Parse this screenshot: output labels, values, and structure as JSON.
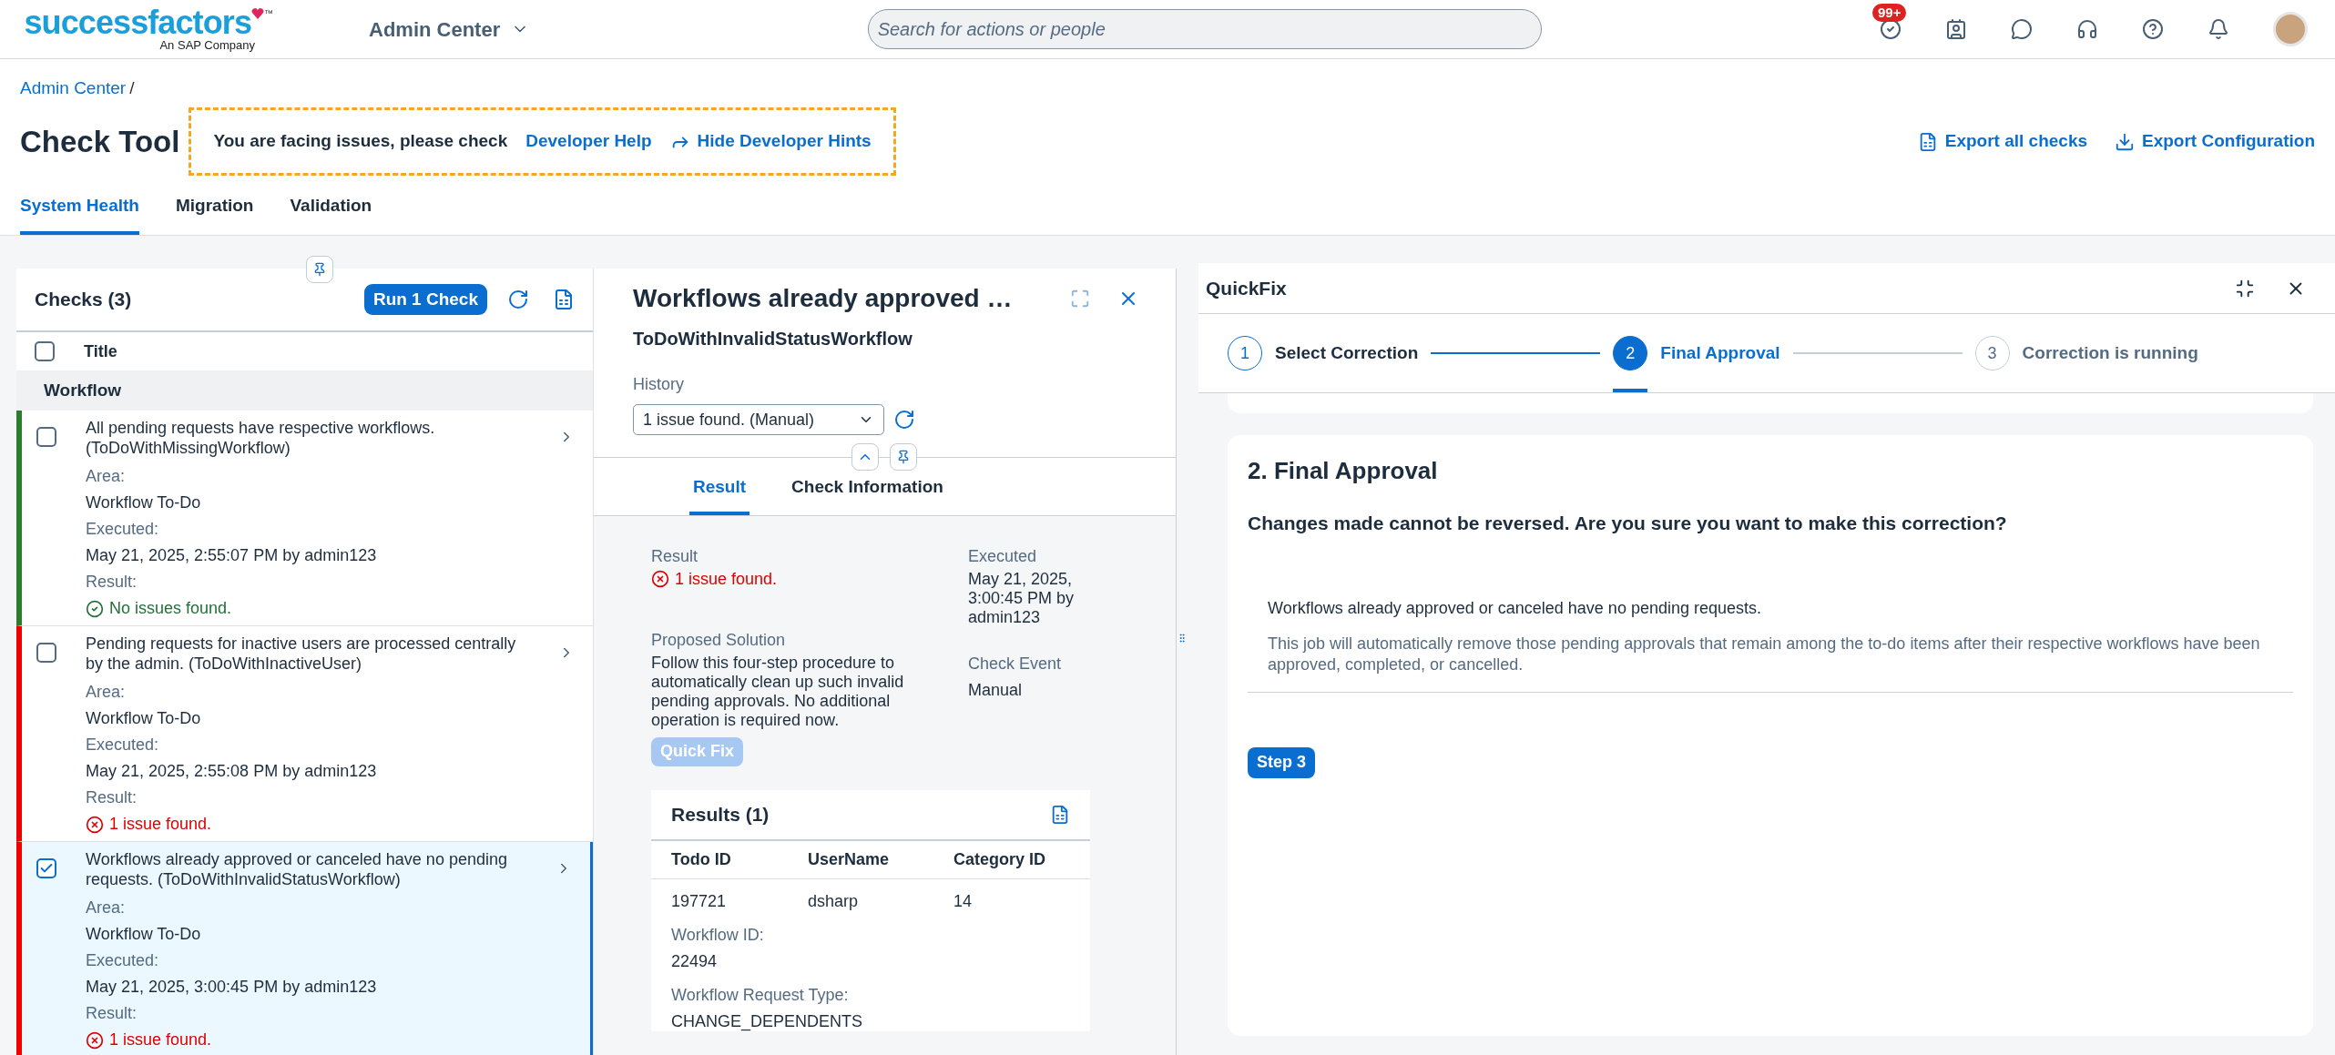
{
  "header": {
    "logo": {
      "name": "successfactors",
      "trademark": "™",
      "tagline": "An SAP Company"
    },
    "app_menu": "Admin Center",
    "search": {
      "placeholder": "Search for actions or people"
    },
    "badge": "99+"
  },
  "breadcrumb": [
    "Admin Center",
    "/"
  ],
  "page": {
    "title": "Check Tool",
    "hint": {
      "text": "You are facing issues, please check",
      "link": "Developer Help",
      "action": "Hide Developer Hints"
    },
    "actions": [
      "Export all checks",
      "Export Configuration"
    ]
  },
  "tabs": [
    {
      "label": "System Health",
      "selected": true
    },
    {
      "label": "Migration",
      "selected": false
    },
    {
      "label": "Validation",
      "selected": false
    }
  ],
  "checks": {
    "title": "Checks (3)",
    "run_button": "Run 1 Check",
    "column": "Title",
    "all_checked": false,
    "group": "Workflow",
    "rows": [
      {
        "title": "All pending requests have respective workflows. (ToDoWithMissingWorkflow)",
        "area_label": "Area:",
        "area": "Workflow To-Do",
        "executed_label": "Executed:",
        "executed": "May 21, 2025, 2:55:07 PM by admin123",
        "result_label": "Result:",
        "result": "No issues found.",
        "kind": "ok",
        "checked": false,
        "selected": false
      },
      {
        "title": "Pending requests for inactive users are processed centrally by the admin. (ToDoWithInactiveUser)",
        "area_label": "Area:",
        "area": "Workflow To-Do",
        "executed_label": "Executed:",
        "executed": "May 21, 2025, 2:55:08 PM by admin123",
        "result_label": "Result:",
        "result": "1 issue found.",
        "kind": "issue",
        "checked": false,
        "selected": false
      },
      {
        "title": "Workflows already approved or canceled have no pending requests. (ToDoWithInvalidStatusWorkflow)",
        "area_label": "Area:",
        "area": "Workflow To-Do",
        "executed_label": "Executed:",
        "executed": "May 21, 2025, 3:00:45 PM by admin123",
        "result_label": "Result:",
        "result": "1 issue found.",
        "kind": "issue",
        "checked": true,
        "selected": true
      }
    ]
  },
  "detail": {
    "title": "Workflows already approved …",
    "subtitle": "ToDoWithInvalidStatusWorkflow",
    "history_label": "History",
    "history_value": "1 issue found. (Manual)",
    "tabs": [
      {
        "label": "Result",
        "selected": true
      },
      {
        "label": "Check Information",
        "selected": false
      }
    ],
    "result_label": "Result",
    "result": {
      "text": "1 issue found.",
      "kind": "issue"
    },
    "executed_label": "Executed",
    "executed": "May 21, 2025, 3:00:45 PM by admin123",
    "solution_label": "Proposed Solution",
    "solution": "Follow this four-step procedure to automatically clean up such invalid pending approvals. No additional operation is required now.",
    "event_label": "Check Event",
    "event": "Manual",
    "quick_fix": {
      "label": "Quick Fix",
      "disabled": true
    },
    "results": {
      "title": "Results (1)",
      "columns": [
        "Todo ID",
        "UserName",
        "Category ID"
      ],
      "rows": [
        {
          "cells": [
            "197721",
            "dsharp",
            "14"
          ],
          "fields": [
            {
              "label": "Workflow ID:",
              "value": "22494"
            },
            {
              "label": "Workflow Request Type:",
              "value": "CHANGE_DEPENDENTS"
            }
          ]
        }
      ]
    }
  },
  "quickfix": {
    "title": "QuickFix",
    "steps": [
      {
        "number": "1",
        "label": "Select Correction",
        "kind": "done"
      },
      {
        "number": "2",
        "label": "Final Approval",
        "kind": "current"
      },
      {
        "number": "3",
        "label": "Correction is running",
        "kind": "pending"
      }
    ],
    "heading": "2. Final Approval",
    "question": "Changes made cannot be reversed. Are you sure you want to make this correction?",
    "item_title": "Workflows already approved or canceled have no pending requests.",
    "item_text": "This job will automatically remove those pending approvals that remain among the to-do items after their respective workflows have been approved, completed, or cancelled.",
    "next_button": "Step 3"
  }
}
